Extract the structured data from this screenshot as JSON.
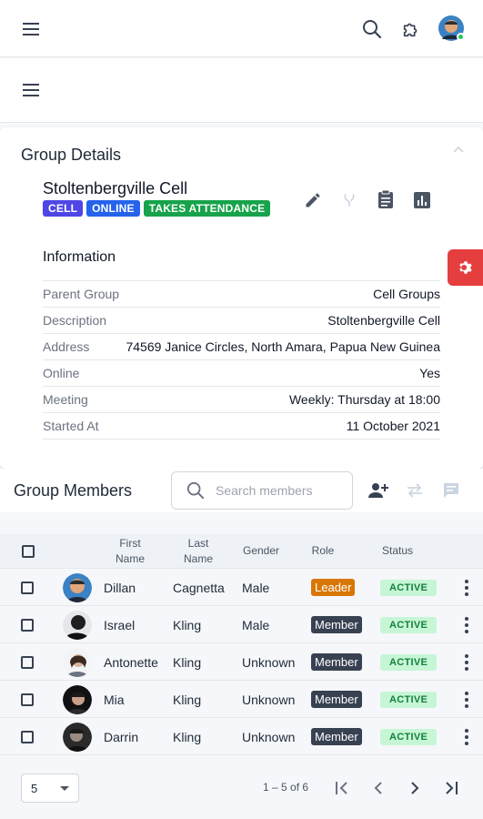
{
  "topbar": {
    "menu_icon": "menu-icon",
    "search_icon": "search-icon",
    "puzzle_icon": "puzzle-icon",
    "avatar_status": "online"
  },
  "subbar": {
    "menu_icon": "menu-icon"
  },
  "group_details": {
    "title": "Group Details",
    "name": "Stoltenbergville Cell",
    "tags": [
      {
        "label": "CELL",
        "color": "#4f46e5"
      },
      {
        "label": "ONLINE",
        "color": "#2563eb"
      },
      {
        "label": "TAKES ATTENDANCE",
        "color": "#16a34a"
      }
    ],
    "actions": [
      "edit-icon",
      "merge-icon",
      "clipboard-icon",
      "chart-icon"
    ],
    "info_title": "Information",
    "info": [
      {
        "label": "Parent Group",
        "value": "Cell Groups"
      },
      {
        "label": "Description",
        "value": "Stoltenbergville Cell"
      },
      {
        "label": "Address",
        "value": "74569 Janice Circles, North Amara, Papua New Guinea"
      },
      {
        "label": "Online",
        "value": "Yes"
      },
      {
        "label": "Meeting",
        "value": "Weekly: Thursday at 18:00"
      },
      {
        "label": "Started At",
        "value": "11 October 2021"
      }
    ]
  },
  "members": {
    "title": "Group Members",
    "search_placeholder": "Search members",
    "columns": {
      "first_name": "First Name",
      "last_name": "Last Name",
      "gender": "Gender",
      "role": "Role",
      "status": "Status"
    },
    "rows": [
      {
        "first": "Dillan",
        "last": "Cagnetta",
        "gender": "Male",
        "role": "Leader",
        "status": "ACTIVE"
      },
      {
        "first": "Israel",
        "last": "Kling",
        "gender": "Male",
        "role": "Member",
        "status": "ACTIVE"
      },
      {
        "first": "Antonette",
        "last": "Kling",
        "gender": "Unknown",
        "role": "Member",
        "status": "ACTIVE"
      },
      {
        "first": "Mia",
        "last": "Kling",
        "gender": "Unknown",
        "role": "Member",
        "status": "ACTIVE"
      },
      {
        "first": "Darrin",
        "last": "Kling",
        "gender": "Unknown",
        "role": "Member",
        "status": "ACTIVE"
      }
    ],
    "role_colors": {
      "Leader": "#d97706",
      "Member": "#374151"
    }
  },
  "pagination": {
    "page_size": "5",
    "range": "1 – 5 of 6"
  }
}
